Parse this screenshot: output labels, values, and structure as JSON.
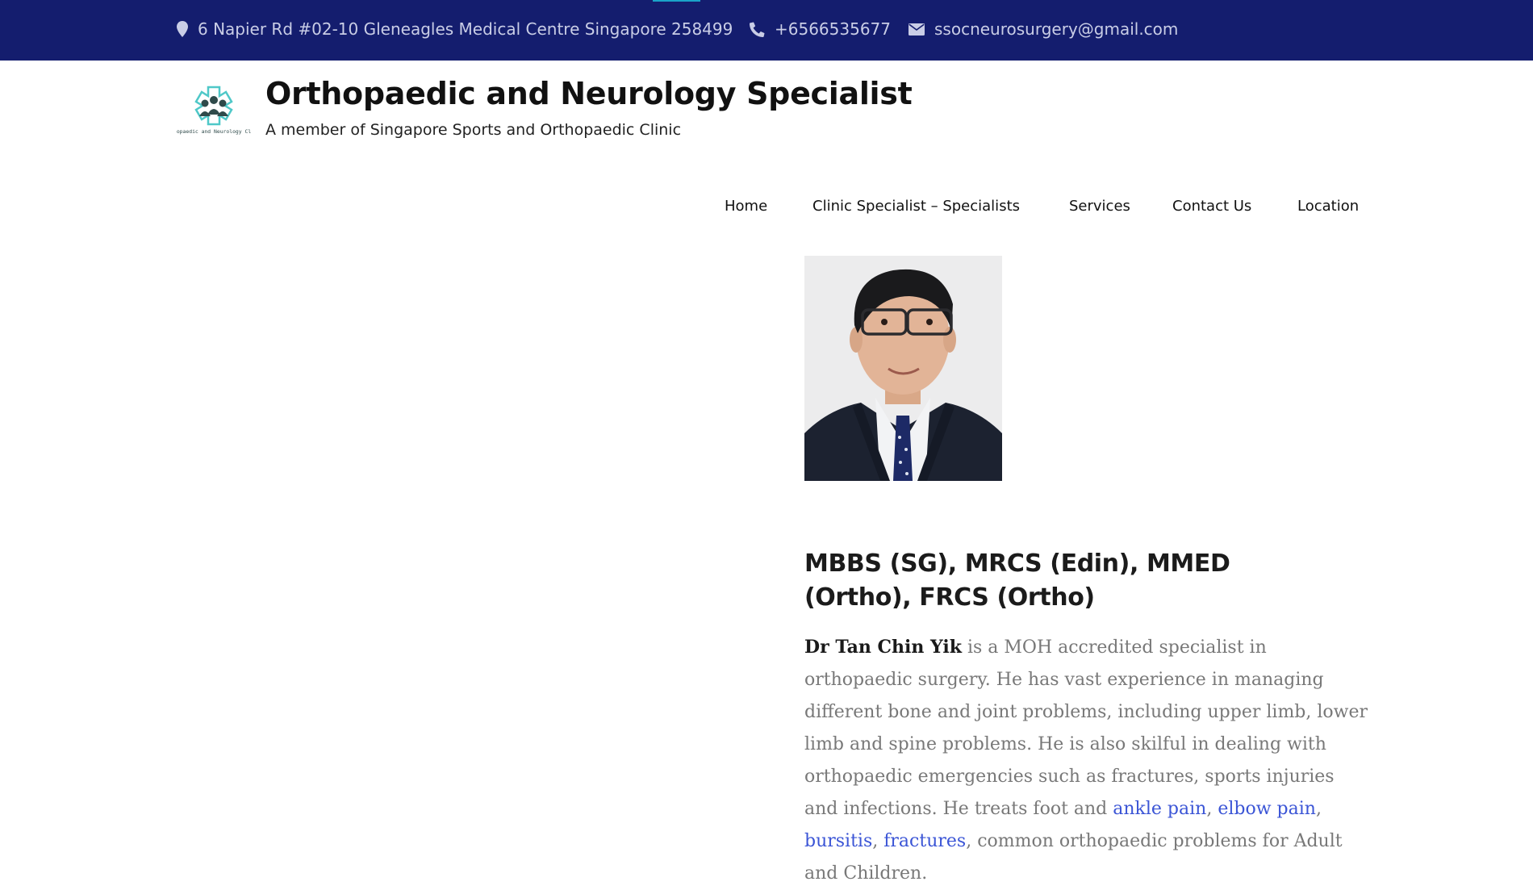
{
  "topbar": {
    "address": "6 Napier Rd #02-10 Gleneagles Medical Centre Singapore 258499",
    "phone": "+6566535677",
    "email": "ssocneurosurgery@gmail.com",
    "bg_color": "#141d6e",
    "accent_color": "#1aa3c8"
  },
  "header": {
    "title": "Orthopaedic and Neurology Specialist",
    "tagline": "A member of Singapore Sports and Orthopaedic Clinic",
    "logo_text": "Orthopaedic and Neurology Clinic"
  },
  "nav": {
    "items": [
      "Home",
      "Clinic Specialist – Specialists",
      "Services",
      "Contact Us",
      "Location"
    ]
  },
  "content": {
    "qualifications": " MBBS (SG), MRCS (Edin), MMED (Ortho), FRCS (Ortho)",
    "doctor_name": "Dr Tan Chin Yik",
    "bio_text_1": " is a MOH accredited specialist in orthopaedic surgery. He has vast experience in managing different bone and joint problems, including upper limb, lower limb and spine problems. He is also skilful in dealing with orthopaedic emergencies such as fractures, sports injuries and infections. He treats foot and ",
    "links": [
      "ankle pain",
      "elbow pain",
      "bursitis",
      "fractures"
    ],
    "sep": ", ",
    "bio_text_2": ", common orthopaedic problems for Adult and Children.",
    "link_color": "#3b55d6"
  },
  "icons": {
    "address": "map-pin-icon",
    "phone": "phone-icon",
    "email": "envelope-icon"
  }
}
